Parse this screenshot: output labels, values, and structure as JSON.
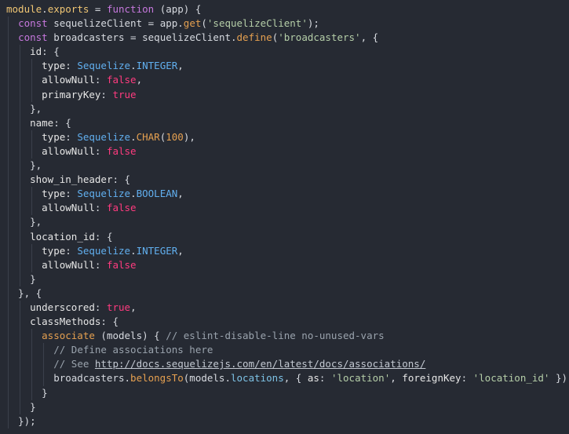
{
  "code_lines": [
    [
      [
        "var",
        "module"
      ],
      [
        "plain",
        "."
      ],
      [
        "var",
        "exports"
      ],
      [
        "plain",
        " = "
      ],
      [
        "kw",
        "function"
      ],
      [
        "plain",
        " (app) {"
      ]
    ],
    [
      [
        "plain",
        "  "
      ],
      [
        "kw",
        "const"
      ],
      [
        "plain",
        " sequelizeClient = app."
      ],
      [
        "fn",
        "get"
      ],
      [
        "plain",
        "("
      ],
      [
        "str",
        "'sequelizeClient'"
      ],
      [
        "plain",
        ");"
      ]
    ],
    [
      [
        "plain",
        "  "
      ],
      [
        "kw",
        "const"
      ],
      [
        "plain",
        " broadcasters = sequelizeClient."
      ],
      [
        "fn",
        "define"
      ],
      [
        "plain",
        "("
      ],
      [
        "str",
        "'broadcasters'"
      ],
      [
        "plain",
        ", {"
      ]
    ],
    [
      [
        "plain",
        "    "
      ],
      [
        "key",
        "id"
      ],
      [
        "plain",
        ": {"
      ]
    ],
    [
      [
        "plain",
        "      "
      ],
      [
        "key",
        "type"
      ],
      [
        "plain",
        ": "
      ],
      [
        "cls",
        "Sequelize"
      ],
      [
        "plain",
        "."
      ],
      [
        "cls",
        "INTEGER"
      ],
      [
        "plain",
        ","
      ]
    ],
    [
      [
        "plain",
        "      "
      ],
      [
        "key",
        "allowNull"
      ],
      [
        "plain",
        ": "
      ],
      [
        "bool",
        "false"
      ],
      [
        "plain",
        ","
      ]
    ],
    [
      [
        "plain",
        "      "
      ],
      [
        "key",
        "primaryKey"
      ],
      [
        "plain",
        ": "
      ],
      [
        "bool",
        "true"
      ]
    ],
    [
      [
        "plain",
        "    },"
      ]
    ],
    [
      [
        "plain",
        "    "
      ],
      [
        "key",
        "name"
      ],
      [
        "plain",
        ": {"
      ]
    ],
    [
      [
        "plain",
        "      "
      ],
      [
        "key",
        "type"
      ],
      [
        "plain",
        ": "
      ],
      [
        "cls",
        "Sequelize"
      ],
      [
        "plain",
        "."
      ],
      [
        "fn",
        "CHAR"
      ],
      [
        "plain",
        "("
      ],
      [
        "num",
        "100"
      ],
      [
        "plain",
        "),"
      ]
    ],
    [
      [
        "plain",
        "      "
      ],
      [
        "key",
        "allowNull"
      ],
      [
        "plain",
        ": "
      ],
      [
        "bool",
        "false"
      ]
    ],
    [
      [
        "plain",
        "    },"
      ]
    ],
    [
      [
        "plain",
        "    "
      ],
      [
        "key",
        "show_in_header"
      ],
      [
        "plain",
        ": {"
      ]
    ],
    [
      [
        "plain",
        "      "
      ],
      [
        "key",
        "type"
      ],
      [
        "plain",
        ": "
      ],
      [
        "cls",
        "Sequelize"
      ],
      [
        "plain",
        "."
      ],
      [
        "cls",
        "BOOLEAN"
      ],
      [
        "plain",
        ","
      ]
    ],
    [
      [
        "plain",
        "      "
      ],
      [
        "key",
        "allowNull"
      ],
      [
        "plain",
        ": "
      ],
      [
        "bool",
        "false"
      ]
    ],
    [
      [
        "plain",
        "    },"
      ]
    ],
    [
      [
        "plain",
        "    "
      ],
      [
        "key",
        "location_id"
      ],
      [
        "plain",
        ": {"
      ]
    ],
    [
      [
        "plain",
        "      "
      ],
      [
        "key",
        "type"
      ],
      [
        "plain",
        ": "
      ],
      [
        "cls",
        "Sequelize"
      ],
      [
        "plain",
        "."
      ],
      [
        "cls",
        "INTEGER"
      ],
      [
        "plain",
        ","
      ]
    ],
    [
      [
        "plain",
        "      "
      ],
      [
        "key",
        "allowNull"
      ],
      [
        "plain",
        ": "
      ],
      [
        "bool",
        "false"
      ]
    ],
    [
      [
        "plain",
        "    }"
      ]
    ],
    [
      [
        "plain",
        "  }, {"
      ]
    ],
    [
      [
        "plain",
        "    "
      ],
      [
        "key",
        "underscored"
      ],
      [
        "plain",
        ": "
      ],
      [
        "bool",
        "true"
      ],
      [
        "plain",
        ","
      ]
    ],
    [
      [
        "plain",
        "    "
      ],
      [
        "key",
        "classMethods"
      ],
      [
        "plain",
        ": {"
      ]
    ],
    [
      [
        "plain",
        "      "
      ],
      [
        "fn",
        "associate"
      ],
      [
        "plain",
        " (models) { "
      ],
      [
        "cmt",
        "// eslint-disable-line no-unused-vars"
      ]
    ],
    [
      [
        "plain",
        "        "
      ],
      [
        "cmt",
        "// Define associations here"
      ]
    ],
    [
      [
        "plain",
        "        "
      ],
      [
        "cmt",
        "// See "
      ],
      [
        "url",
        "http://docs.sequelizejs.com/en/latest/docs/associations/"
      ]
    ],
    [
      [
        "plain",
        "        broadcasters."
      ],
      [
        "fn",
        "belongsTo"
      ],
      [
        "plain",
        "(models."
      ],
      [
        "prop",
        "locations"
      ],
      [
        "plain",
        ", { "
      ],
      [
        "key",
        "as"
      ],
      [
        "plain",
        ": "
      ],
      [
        "str",
        "'location'"
      ],
      [
        "plain",
        ", "
      ],
      [
        "key",
        "foreignKey"
      ],
      [
        "plain",
        ": "
      ],
      [
        "str",
        "'location_id'"
      ],
      [
        "plain",
        " });"
      ]
    ],
    [
      [
        "plain",
        "      }"
      ]
    ],
    [
      [
        "plain",
        "    }"
      ]
    ],
    [
      [
        "plain",
        "  });"
      ]
    ]
  ],
  "colors": {
    "background": "#262a33",
    "indent_guide": "#3b404b"
  }
}
